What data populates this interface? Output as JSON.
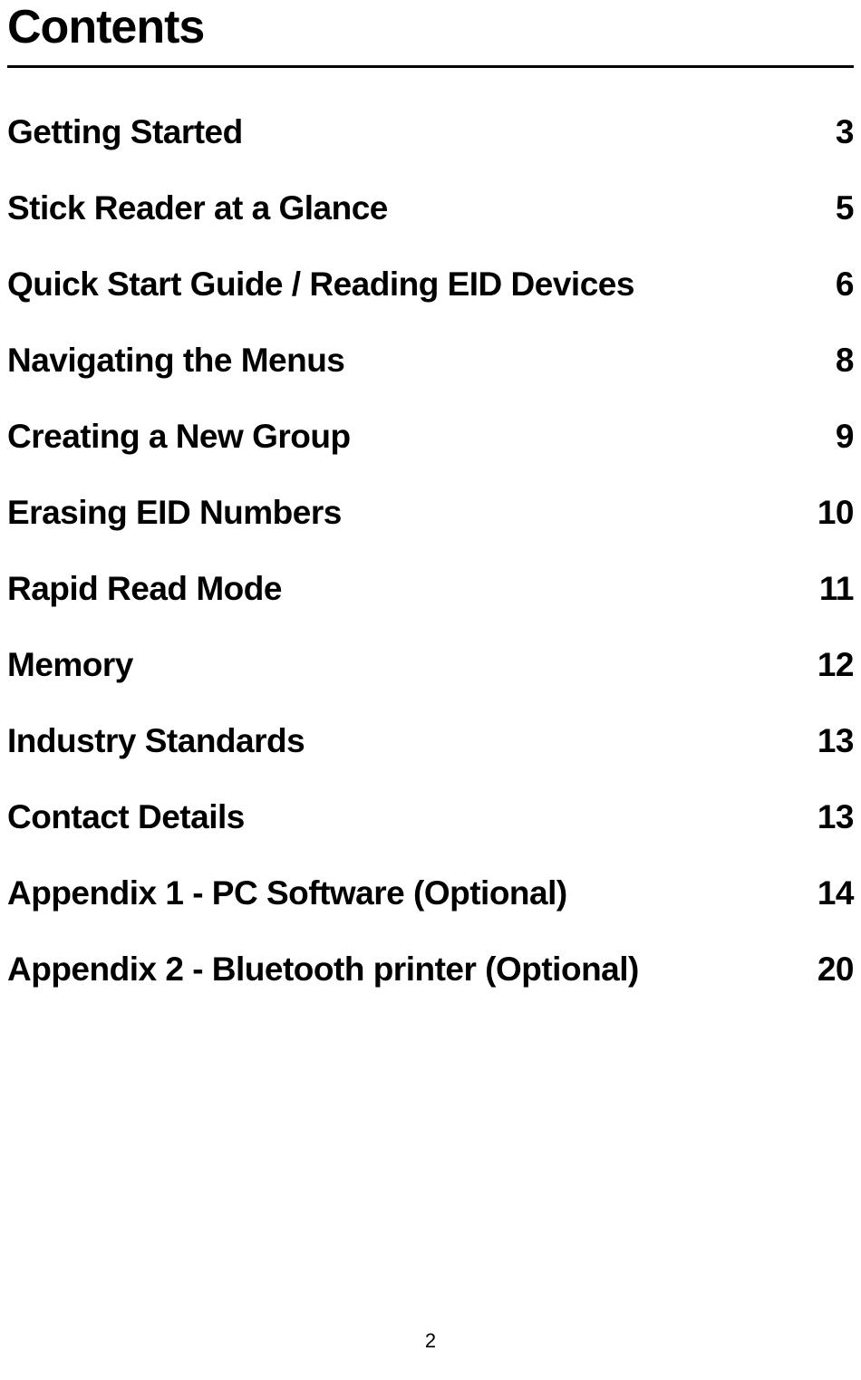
{
  "title": "Contents",
  "entries": [
    {
      "title": "Getting Started",
      "page": "3"
    },
    {
      "title": "Stick Reader at a Glance",
      "page": "5"
    },
    {
      "title": "Quick Start Guide / Reading EID Devices",
      "page": "6"
    },
    {
      "title": "Navigating the Menus",
      "page": "8"
    },
    {
      "title": "Creating a New Group",
      "page": "9"
    },
    {
      "title": "Erasing EID Numbers",
      "page": "10"
    },
    {
      "title": "Rapid Read Mode",
      "page": "11"
    },
    {
      "title": "Memory",
      "page": "12"
    },
    {
      "title": "Industry Standards",
      "page": "13"
    },
    {
      "title": "Contact Details",
      "page": "13"
    },
    {
      "title": "Appendix 1 - PC Software (Optional)",
      "page": "14"
    },
    {
      "title": "Appendix 2 - Bluetooth printer (Optional)",
      "page": "20"
    }
  ],
  "page_number": "2"
}
